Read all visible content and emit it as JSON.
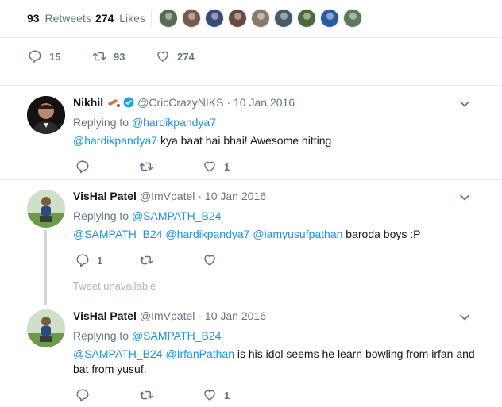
{
  "stats": {
    "retweets_count": "93",
    "retweets_label": "Retweets",
    "likes_count": "274",
    "likes_label": "Likes",
    "likers": [
      {
        "color": "#5a6a55"
      },
      {
        "color": "#7a5a48"
      },
      {
        "color": "#3a4a78"
      },
      {
        "color": "#6a4a3a"
      },
      {
        "color": "#8a7a6a"
      },
      {
        "color": "#4a5a6a"
      },
      {
        "color": "#4a6a3a"
      },
      {
        "color": "#2a5aa0"
      },
      {
        "color": "#5a7a5a"
      }
    ]
  },
  "main_actions": {
    "replies": "15",
    "retweets": "93",
    "likes": "274"
  },
  "replies": [
    {
      "fullname": "Nikhil",
      "handle": "@CricCrazyNIKS",
      "time": "· 10 Jan 2016",
      "replying_label": "Replying to",
      "replying_to": "@hardikpandya7",
      "mentions": "@hardikpandya7",
      "body": " kya baat hai bhai! Awesome hitting",
      "reply_count": "",
      "like_count": "1"
    },
    {
      "fullname": "VisHal Patel",
      "handle": "@ImVpatel",
      "time": "· 10 Jan 2016",
      "replying_label": "Replying to",
      "replying_to": "@SAMPATH_B24",
      "mentions": "@SAMPATH_B24 @hardikpandya7 @iamyusufpathan",
      "body": " baroda boys :P",
      "reply_count": "1",
      "like_count": ""
    },
    {
      "fullname": "VisHal Patel",
      "handle": "@ImVpatel",
      "time": "· 10 Jan 2016",
      "replying_label": "Replying to",
      "replying_to": "@SAMPATH_B24",
      "mentions": "@SAMPATH_B24 @IrfanPathan",
      "body": " is his idol seems he learn bowling from irfan and bat from yusuf.",
      "reply_count": "",
      "like_count": "1"
    }
  ],
  "tweet_unavailable": "Tweet unavailable",
  "colors": {
    "link": "#1b95e0",
    "muted": "#657786",
    "divider": "#e6ecf0",
    "thread_line": "#ccd6dd"
  }
}
